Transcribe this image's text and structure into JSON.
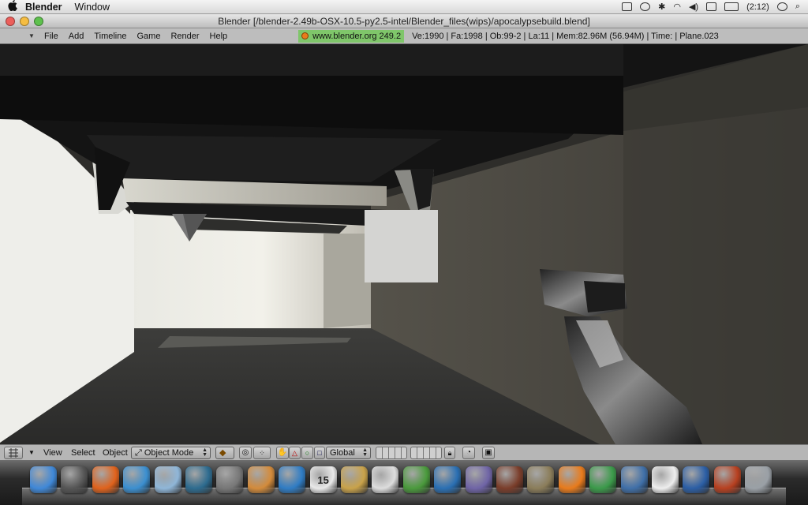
{
  "menubar": {
    "apple": "",
    "app_name": "Blender",
    "items": [
      "Window"
    ],
    "clock": "(2:12)",
    "icons": [
      "spaces-icon",
      "time-machine-icon",
      "bluetooth-icon",
      "wifi-icon",
      "volume-icon",
      "input-menu-icon",
      "battery-icon",
      "clock-icon",
      "spotlight-icon"
    ]
  },
  "window": {
    "title": "Blender [/blender-2.49b-OSX-10.5-py2.5-intel/Blender_files(wips)/apocalypsebuild.blend]",
    "traffic_lights": [
      "#ec5f5b",
      "#f5bd42",
      "#5ec14d"
    ]
  },
  "blender_header": {
    "menus": [
      "File",
      "Add",
      "Timeline",
      "Game",
      "Render",
      "Help"
    ],
    "url": "www.blender.org 249.2",
    "stats": "Ve:1990 | Fa:1998 | Ob:99-2 | La:11  | Mem:82.96M (56.94M)  | Time: | Plane.023"
  },
  "view_header": {
    "menus": [
      "View",
      "Select",
      "Object"
    ],
    "mode": "Object Mode",
    "orientation": "Global"
  },
  "dock": {
    "apps": [
      {
        "name": "Finder",
        "color": "#3f88d8"
      },
      {
        "name": "Dashboard",
        "color": "#555"
      },
      {
        "name": "Firefox",
        "color": "#e0621c"
      },
      {
        "name": "iTunes",
        "color": "#3b8fd0"
      },
      {
        "name": "Mail",
        "color": "#8fb6d8"
      },
      {
        "name": "Time Machine",
        "color": "#2d6b8f"
      },
      {
        "name": "System Preferences",
        "color": "#777"
      },
      {
        "name": "Keynote",
        "color": "#d38b3b"
      },
      {
        "name": "Safari",
        "color": "#2f7cc4"
      },
      {
        "name": "iCal",
        "color": "#e9e9e9",
        "text": "15"
      },
      {
        "name": "iMovie",
        "color": "#c9a24a"
      },
      {
        "name": "Sheep",
        "color": "#dddddd"
      },
      {
        "name": "Photo",
        "color": "#4a9a3c"
      },
      {
        "name": "QuickTime",
        "color": "#2a6fb3"
      },
      {
        "name": "Automator",
        "color": "#6f64a6"
      },
      {
        "name": "Game",
        "color": "#7a3d2a"
      },
      {
        "name": "GIMP",
        "color": "#8b7d5a"
      },
      {
        "name": "Blender",
        "color": "#e87b1c"
      },
      {
        "name": "The Sims",
        "color": "#3b9a4a"
      },
      {
        "name": "Python",
        "color": "#3f6fa8"
      },
      {
        "name": "Preview",
        "color": "#eeeeee"
      },
      {
        "name": "VirtualBox",
        "color": "#2b5ea5"
      },
      {
        "name": "Cube App",
        "color": "#b74020"
      },
      {
        "name": "Trash",
        "color": "#9aa0a6"
      }
    ]
  }
}
